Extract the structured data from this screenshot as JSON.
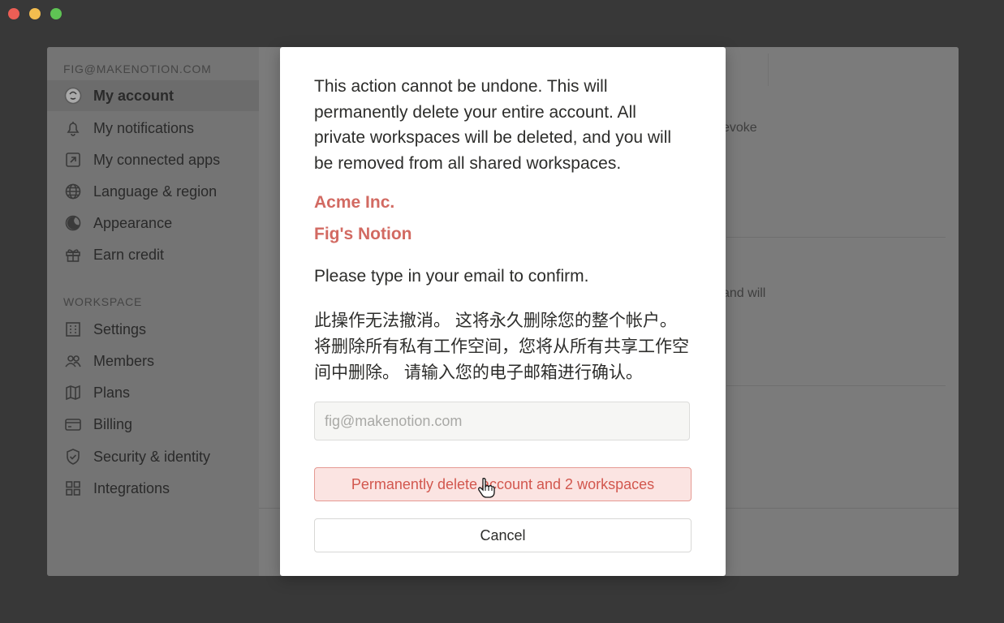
{
  "sidebar": {
    "account_email": "FIG@MAKENOTION.COM",
    "account_items": [
      {
        "label": "My account",
        "icon": "avatar-icon"
      },
      {
        "label": "My notifications",
        "icon": "bell-icon"
      },
      {
        "label": "My connected apps",
        "icon": "external-link-icon"
      },
      {
        "label": "Language & region",
        "icon": "globe-icon"
      },
      {
        "label": "Appearance",
        "icon": "moon-icon"
      },
      {
        "label": "Earn credit",
        "icon": "gift-icon"
      }
    ],
    "workspace_label": "WORKSPACE",
    "workspace_items": [
      {
        "label": "Settings",
        "icon": "building-icon"
      },
      {
        "label": "Members",
        "icon": "people-icon"
      },
      {
        "label": "Plans",
        "icon": "map-icon"
      },
      {
        "label": "Billing",
        "icon": "credit-card-icon"
      },
      {
        "label": "Security & identity",
        "icon": "shield-icon"
      },
      {
        "label": "Integrations",
        "icon": "grid-icon"
      }
    ]
  },
  "background": {
    "fragment_1": "evoke",
    "fragment_2": "and will"
  },
  "modal": {
    "warning": "This action cannot be undone. This will permanently delete your entire account. All private workspaces will be deleted, and you will be removed from all shared workspaces.",
    "workspaces": [
      "Acme Inc.",
      "Fig's Notion"
    ],
    "confirm_prompt": "Please type in your email to confirm.",
    "chinese_text": "此操作无法撤消。 这将永久删除您的整个帐户。 将删除所有私有工作空间，您将从所有共享工作空间中删除。 请输入您的电子邮箱进行确认。",
    "email_placeholder": "fig@makenotion.com",
    "delete_button": "Permanently delete account and 2 workspaces",
    "cancel_button": "Cancel"
  },
  "colors": {
    "danger": "#d2574e",
    "workspace_name": "#d26a62"
  }
}
